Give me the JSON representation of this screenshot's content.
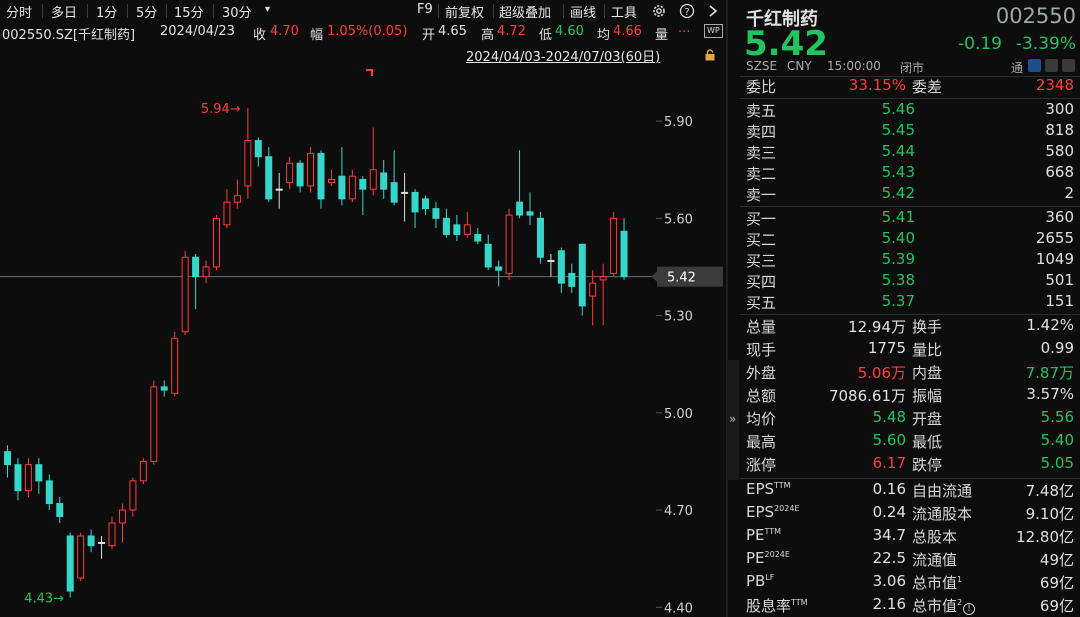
{
  "toolbar": {
    "tabs": [
      "分时",
      "多日",
      "1分",
      "5分",
      "15分",
      "30分"
    ],
    "dropdown_arrow": "▾",
    "tools": [
      "F9",
      "前复权",
      "超级叠加",
      "画线",
      "工具"
    ],
    "icons": [
      "gear-icon",
      "help-icon",
      "chevron-right-icon"
    ]
  },
  "info": {
    "code": "002550.SZ[千红制药]",
    "date": "2024/04/23",
    "close_label": "收",
    "close_value": "4.70",
    "change_label": "幅",
    "change_value": "1.05%(0.05)",
    "open_label": "开",
    "open_value": "4.65",
    "high_label": "高",
    "high_value": "4.72",
    "low_label": "低",
    "low_value": "4.60",
    "avg_label": "均",
    "avg_value": "4.66",
    "vol_label": "量",
    "more": "...",
    "wp_badge": "WP"
  },
  "range": "2024/04/03-2024/07/03(60日)",
  "chart_data": {
    "type": "candlestick",
    "y_ticks": [
      "5.90",
      "5.60",
      "5.30",
      "5.00",
      "4.70",
      "4.40"
    ],
    "ylim": [
      4.37,
      6.07
    ],
    "current_price_label": "5.42",
    "max_marker": "5.94",
    "min_marker": "4.43",
    "up_color": "#ff3b3b",
    "down_color": "#37d6cb",
    "candles": [
      {
        "o": 4.88,
        "c": 4.84,
        "h": 4.9,
        "l": 4.8
      },
      {
        "o": 4.84,
        "c": 4.76,
        "h": 4.86,
        "l": 4.73
      },
      {
        "o": 4.76,
        "c": 4.84,
        "h": 4.86,
        "l": 4.74
      },
      {
        "o": 4.84,
        "c": 4.79,
        "h": 4.86,
        "l": 4.75
      },
      {
        "o": 4.79,
        "c": 4.72,
        "h": 4.81,
        "l": 4.7
      },
      {
        "o": 4.72,
        "c": 4.68,
        "h": 4.74,
        "l": 4.66
      },
      {
        "o": 4.62,
        "c": 4.45,
        "h": 4.63,
        "l": 4.43
      },
      {
        "o": 4.49,
        "c": 4.62,
        "h": 4.63,
        "l": 4.48
      },
      {
        "o": 4.62,
        "c": 4.59,
        "h": 4.64,
        "l": 4.57
      },
      {
        "o": 4.6,
        "c": 4.6,
        "h": 4.62,
        "l": 4.55
      },
      {
        "o": 4.59,
        "c": 4.66,
        "h": 4.68,
        "l": 4.58
      },
      {
        "o": 4.66,
        "c": 4.7,
        "h": 4.72,
        "l": 4.6
      },
      {
        "o": 4.7,
        "c": 4.79,
        "h": 4.8,
        "l": 4.68
      },
      {
        "o": 4.79,
        "c": 4.85,
        "h": 4.86,
        "l": 4.78
      },
      {
        "o": 4.85,
        "c": 5.08,
        "h": 5.1,
        "l": 4.84
      },
      {
        "o": 5.08,
        "c": 5.07,
        "h": 5.1,
        "l": 5.05
      },
      {
        "o": 5.06,
        "c": 5.23,
        "h": 5.25,
        "l": 5.05
      },
      {
        "o": 5.25,
        "c": 5.48,
        "h": 5.5,
        "l": 5.24
      },
      {
        "o": 5.48,
        "c": 5.42,
        "h": 5.49,
        "l": 5.32
      },
      {
        "o": 5.42,
        "c": 5.45,
        "h": 5.47,
        "l": 5.4
      },
      {
        "o": 5.45,
        "c": 5.6,
        "h": 5.61,
        "l": 5.44
      },
      {
        "o": 5.58,
        "c": 5.65,
        "h": 5.69,
        "l": 5.57
      },
      {
        "o": 5.65,
        "c": 5.67,
        "h": 5.72,
        "l": 5.63
      },
      {
        "o": 5.7,
        "c": 5.84,
        "h": 5.94,
        "l": 5.66
      },
      {
        "o": 5.84,
        "c": 5.79,
        "h": 5.85,
        "l": 5.76
      },
      {
        "o": 5.79,
        "c": 5.66,
        "h": 5.82,
        "l": 5.65
      },
      {
        "o": 5.69,
        "c": 5.69,
        "h": 5.74,
        "l": 5.63
      },
      {
        "o": 5.71,
        "c": 5.77,
        "h": 5.79,
        "l": 5.69
      },
      {
        "o": 5.77,
        "c": 5.7,
        "h": 5.78,
        "l": 5.68
      },
      {
        "o": 5.7,
        "c": 5.8,
        "h": 5.82,
        "l": 5.68
      },
      {
        "o": 5.8,
        "c": 5.66,
        "h": 5.81,
        "l": 5.63
      },
      {
        "o": 5.71,
        "c": 5.72,
        "h": 5.75,
        "l": 5.7
      },
      {
        "o": 5.73,
        "c": 5.66,
        "h": 5.82,
        "l": 5.64
      },
      {
        "o": 5.66,
        "c": 5.73,
        "h": 5.75,
        "l": 5.65
      },
      {
        "o": 5.72,
        "c": 5.69,
        "h": 5.73,
        "l": 5.61
      },
      {
        "o": 5.69,
        "c": 5.75,
        "h": 5.88,
        "l": 5.67
      },
      {
        "o": 5.74,
        "c": 5.69,
        "h": 5.78,
        "l": 5.66
      },
      {
        "o": 5.71,
        "c": 5.65,
        "h": 5.81,
        "l": 5.64
      },
      {
        "o": 5.68,
        "c": 5.68,
        "h": 5.74,
        "l": 5.59
      },
      {
        "o": 5.68,
        "c": 5.62,
        "h": 5.69,
        "l": 5.57
      },
      {
        "o": 5.66,
        "c": 5.63,
        "h": 5.67,
        "l": 5.61
      },
      {
        "o": 5.63,
        "c": 5.6,
        "h": 5.65,
        "l": 5.57
      },
      {
        "o": 5.6,
        "c": 5.55,
        "h": 5.63,
        "l": 5.54
      },
      {
        "o": 5.58,
        "c": 5.55,
        "h": 5.61,
        "l": 5.53
      },
      {
        "o": 5.55,
        "c": 5.58,
        "h": 5.62,
        "l": 5.54
      },
      {
        "o": 5.55,
        "c": 5.53,
        "h": 5.57,
        "l": 5.52
      },
      {
        "o": 5.52,
        "c": 5.45,
        "h": 5.55,
        "l": 5.44
      },
      {
        "o": 5.45,
        "c": 5.44,
        "h": 5.47,
        "l": 5.39
      },
      {
        "o": 5.43,
        "c": 5.61,
        "h": 5.63,
        "l": 5.41
      },
      {
        "o": 5.65,
        "c": 5.61,
        "h": 5.81,
        "l": 5.6
      },
      {
        "o": 5.62,
        "c": 5.61,
        "h": 5.68,
        "l": 5.58
      },
      {
        "o": 5.6,
        "c": 5.48,
        "h": 5.62,
        "l": 5.46
      },
      {
        "o": 5.47,
        "c": 5.47,
        "h": 5.49,
        "l": 5.42
      },
      {
        "o": 5.5,
        "c": 5.4,
        "h": 5.51,
        "l": 5.37
      },
      {
        "o": 5.43,
        "c": 5.39,
        "h": 5.46,
        "l": 5.37
      },
      {
        "o": 5.52,
        "c": 5.33,
        "h": 5.52,
        "l": 5.3
      },
      {
        "o": 5.36,
        "c": 5.4,
        "h": 5.44,
        "l": 5.27
      },
      {
        "o": 5.41,
        "c": 5.42,
        "h": 5.46,
        "l": 5.27
      },
      {
        "o": 5.43,
        "c": 5.6,
        "h": 5.62,
        "l": 5.42
      },
      {
        "o": 5.56,
        "c": 5.42,
        "h": 5.6,
        "l": 5.41
      }
    ]
  },
  "quote": {
    "name": "千红制药",
    "code": "002550",
    "price": "5.42",
    "change": "-0.19",
    "change_pct": "-3.39%",
    "exchange": "SZSE",
    "currency": "CNY",
    "time": "15:00:00",
    "status": "闭市",
    "tong_label": "通"
  },
  "committee": {
    "ratio_label": "委比",
    "ratio_value": "33.15%",
    "diff_label": "委差",
    "diff_value": "2348"
  },
  "asks": [
    {
      "label": "卖五",
      "price": "5.46",
      "vol": "300"
    },
    {
      "label": "卖四",
      "price": "5.45",
      "vol": "818"
    },
    {
      "label": "卖三",
      "price": "5.44",
      "vol": "580"
    },
    {
      "label": "卖二",
      "price": "5.43",
      "vol": "668"
    },
    {
      "label": "卖一",
      "price": "5.42",
      "vol": "2"
    }
  ],
  "bids": [
    {
      "label": "买一",
      "price": "5.41",
      "vol": "360"
    },
    {
      "label": "买二",
      "price": "5.40",
      "vol": "2655"
    },
    {
      "label": "买三",
      "price": "5.39",
      "vol": "1049"
    },
    {
      "label": "买四",
      "price": "5.38",
      "vol": "501"
    },
    {
      "label": "买五",
      "price": "5.37",
      "vol": "151"
    }
  ],
  "stats": [
    {
      "l1": "总量",
      "v1": "12.94万",
      "c1": "wh",
      "l2": "换手",
      "v2": "1.42%",
      "c2": "wh"
    },
    {
      "l1": "现手",
      "v1": "1775",
      "c1": "wh",
      "l2": "量比",
      "v2": "0.99",
      "c2": "wh"
    },
    {
      "l1": "外盘",
      "v1": "5.06万",
      "c1": "up",
      "l2": "内盘",
      "v2": "7.87万",
      "c2": "dn"
    },
    {
      "l1": "总额",
      "v1": "7086.61万",
      "c1": "wh",
      "l2": "振幅",
      "v2": "3.57%",
      "c2": "wh"
    },
    {
      "l1": "均价",
      "v1": "5.48",
      "c1": "dn",
      "l2": "开盘",
      "v2": "5.56",
      "c2": "dn"
    },
    {
      "l1": "最高",
      "v1": "5.60",
      "c1": "dn",
      "l2": "最低",
      "v2": "5.40",
      "c2": "dn"
    },
    {
      "l1": "涨停",
      "v1": "6.17",
      "c1": "up",
      "l2": "跌停",
      "v2": "5.05",
      "c2": "dn"
    }
  ],
  "fundamentals": [
    {
      "l1": "EPS",
      "s1": "TTM",
      "v1": "0.16",
      "l2": "自由流通",
      "s2": "",
      "v2": "7.48亿"
    },
    {
      "l1": "EPS",
      "s1": "2024E",
      "v1": "0.24",
      "l2": "流通股本",
      "s2": "",
      "v2": "9.10亿"
    },
    {
      "l1": "PE",
      "s1": "TTM",
      "v1": "34.7",
      "l2": "总股本",
      "s2": "",
      "v2": "12.80亿"
    },
    {
      "l1": "PE",
      "s1": "2024E",
      "v1": "22.5",
      "l2": "流通值",
      "s2": "",
      "v2": "49亿"
    },
    {
      "l1": "PB",
      "s1": "LF",
      "v1": "3.06",
      "l2": "总市值",
      "s2": "1",
      "v2": "69亿"
    },
    {
      "l1": "股息率",
      "s1": "TTM",
      "v1": "2.16",
      "l2": "总市值",
      "s2": "2",
      "v2": "69亿"
    }
  ]
}
